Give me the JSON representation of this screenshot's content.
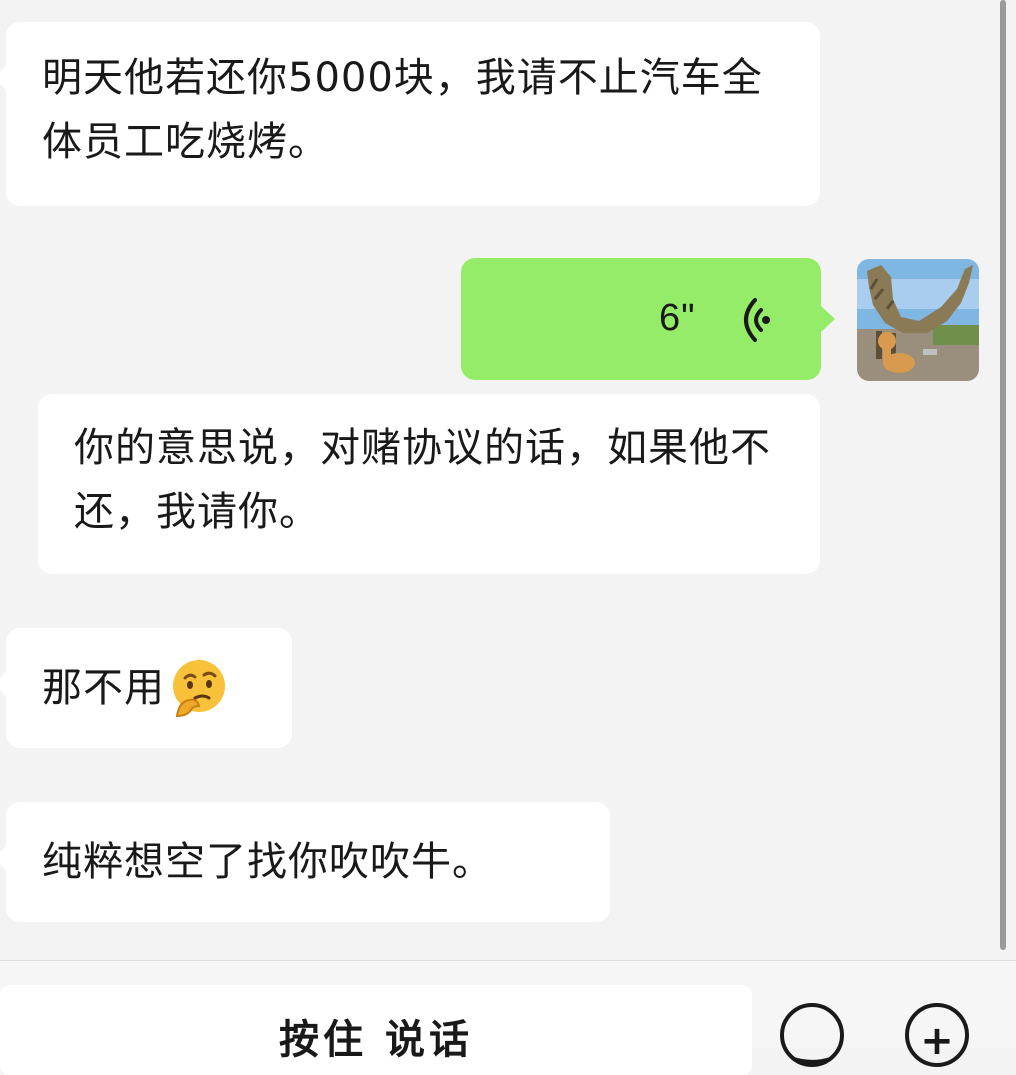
{
  "messages": [
    {
      "from": "contact",
      "text": "明天他若还你5000块，我请不止汽车全体员工吃烧烤。"
    },
    {
      "from": "me",
      "type": "voice",
      "duration": "6\""
    },
    {
      "from": "contact",
      "text": "你的意思说，对赌协议的话，如果他不还，我请你。"
    },
    {
      "from": "contact",
      "text": "那不用",
      "emoji": "thinking-face"
    },
    {
      "from": "contact",
      "text": "纯粹想空了找你吹吹牛。"
    }
  ],
  "footer": {
    "hold_to_talk_label": "按住 说话",
    "emoji_button_icon": "smiley-icon",
    "plus_button_icon": "plus-icon"
  },
  "colors": {
    "background": "#f3f3f3",
    "incoming_bubble": "#ffffff",
    "outgoing_bubble": "#95ec69",
    "text": "#191919"
  }
}
